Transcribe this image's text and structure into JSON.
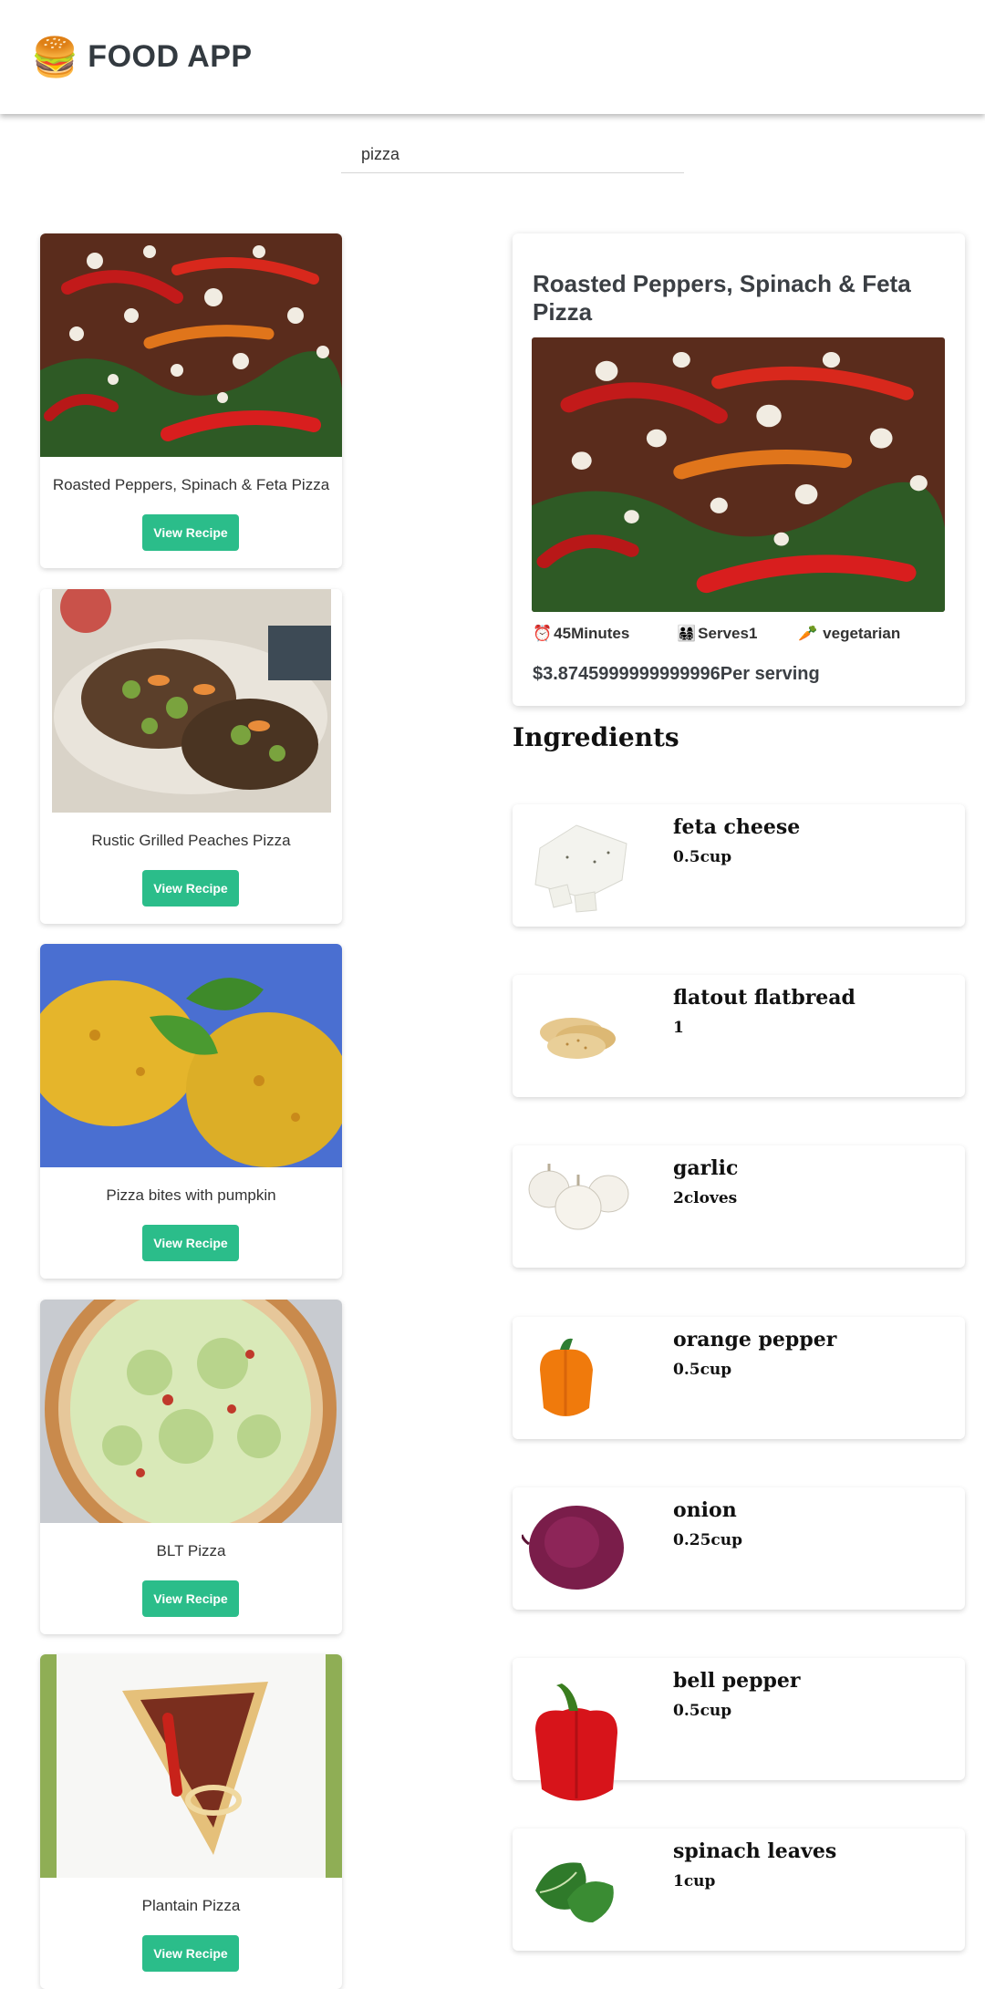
{
  "header": {
    "logo_icon": "burger-icon",
    "title": "FOOD APP"
  },
  "search": {
    "value": "pizza"
  },
  "recipes": [
    {
      "title": "Roasted Peppers, Spinach & Feta Pizza",
      "button": "View Recipe",
      "image": "pizza-peppers-spinach-feta"
    },
    {
      "title": "Rustic Grilled Peaches Pizza",
      "button": "View Recipe",
      "image": "pizza-grilled-peaches"
    },
    {
      "title": "Pizza bites with pumpkin",
      "button": "View Recipe",
      "image": "pizza-bites-pumpkin"
    },
    {
      "title": "BLT Pizza",
      "button": "View Recipe",
      "image": "blt-pizza"
    },
    {
      "title": "Plantain Pizza",
      "button": "View Recipe",
      "image": "plantain-pizza"
    }
  ],
  "detail": {
    "title": "Roasted Peppers, Spinach & Feta Pizza",
    "time": "45Minutes",
    "serves": "Serves1",
    "diet": "vegetarian",
    "price": "$3.8745999999999996Per serving"
  },
  "ingredients_heading": "Ingredients",
  "ingredients": [
    {
      "name": "feta cheese",
      "amount": "0.5cup",
      "image": "feta-cheese"
    },
    {
      "name": "flatout flatbread",
      "amount": "1",
      "image": "flatbread"
    },
    {
      "name": "garlic",
      "amount": "2cloves",
      "image": "garlic"
    },
    {
      "name": "orange pepper",
      "amount": "0.5cup",
      "image": "orange-pepper"
    },
    {
      "name": "onion",
      "amount": "0.25cup",
      "image": "onion"
    },
    {
      "name": "bell pepper",
      "amount": "0.5cup",
      "image": "bell-pepper"
    },
    {
      "name": "spinach leaves",
      "amount": "1cup",
      "image": "spinach"
    }
  ],
  "colors": {
    "accent": "#2bbd8a",
    "title_text": "#3b3f44"
  }
}
